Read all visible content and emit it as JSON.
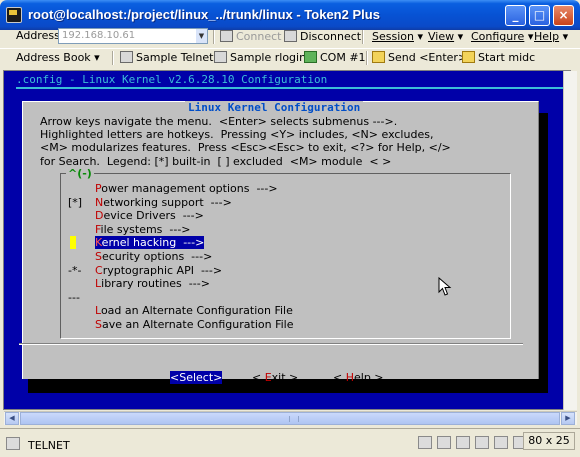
{
  "window": {
    "title": "root@localhost:/project/linux_../trunk/linux - Token2 Plus",
    "buttons": {
      "minimize": "_",
      "maximize": "□",
      "close": "×"
    }
  },
  "toolbar1": {
    "address_label": "Address",
    "address_value": "192.168.10.61",
    "connect": "Connect",
    "disconnect": "Disconnect",
    "menus": [
      "Session",
      "View",
      "Configure",
      "Help"
    ]
  },
  "toolbar2": {
    "address_book": "Address Book",
    "sample_telnet": "Sample Telnet",
    "sample_rlogin": "Sample rlogin",
    "com1": "COM #1",
    "send_enter": "Send <Enter>",
    "start_midc": "Start midc"
  },
  "terminal": {
    "header": ".config - Linux Kernel v2.6.28.10 Configuration",
    "dialog_title": "Linux Kernel Configuration",
    "help_lines": [
      "Arrow keys navigate the menu.  <Enter> selects submenus --->.",
      "Highlighted letters are hotkeys.  Pressing <Y> includes, <N> excludes,",
      "<M> modularizes features.  Press <Esc><Esc> to exit, <?> for Help, </>",
      "for Search.  Legend: [*] built-in  [ ] excluded  <M> module  < >"
    ],
    "more_indicator": "^(-)",
    "menu_items": [
      {
        "prefix": "",
        "hotkey": "P",
        "rest": "ower management options  --->",
        "selected": false
      },
      {
        "prefix": "[*]",
        "hotkey": "N",
        "rest": "etworking support  --->",
        "selected": false
      },
      {
        "prefix": "",
        "hotkey": "D",
        "rest": "evice Drivers  --->",
        "selected": false
      },
      {
        "prefix": "",
        "hotkey": "F",
        "rest": "ile systems  --->",
        "selected": false
      },
      {
        "prefix": "",
        "hotkey": "K",
        "rest": "ernel hacking  --->",
        "selected": true
      },
      {
        "prefix": "",
        "hotkey": "S",
        "rest": "ecurity options  --->",
        "selected": false
      },
      {
        "prefix": "-*-",
        "hotkey": "C",
        "rest": "ryptographic API  --->",
        "selected": false
      },
      {
        "prefix": "",
        "hotkey": "L",
        "rest": "ibrary routines  --->",
        "selected": false
      },
      {
        "prefix": "---",
        "hotkey": "",
        "rest": "",
        "selected": false
      },
      {
        "prefix": "",
        "hotkey": "L",
        "rest": "oad an Alternate Configuration File",
        "selected": false
      },
      {
        "prefix": "",
        "hotkey": "S",
        "rest": "ave an Alternate Configuration File",
        "selected": false
      }
    ],
    "buttons": [
      {
        "pre": "<",
        "hotkey": "S",
        "rest": "elect>",
        "selected": true
      },
      {
        "pre": "< ",
        "hotkey": "E",
        "rest": "xit >",
        "selected": false
      },
      {
        "pre": "< ",
        "hotkey": "H",
        "rest": "elp >",
        "selected": false
      }
    ]
  },
  "status": {
    "protocol": "TELNET",
    "size": "80 x 25"
  },
  "colors": {
    "terminal_bg": "#0000a8",
    "dialog_bg": "#c0c0c0",
    "header_cyan": "#3cbcd8",
    "hotkey_red": "#c00000",
    "title_blue": "#0752d4"
  }
}
